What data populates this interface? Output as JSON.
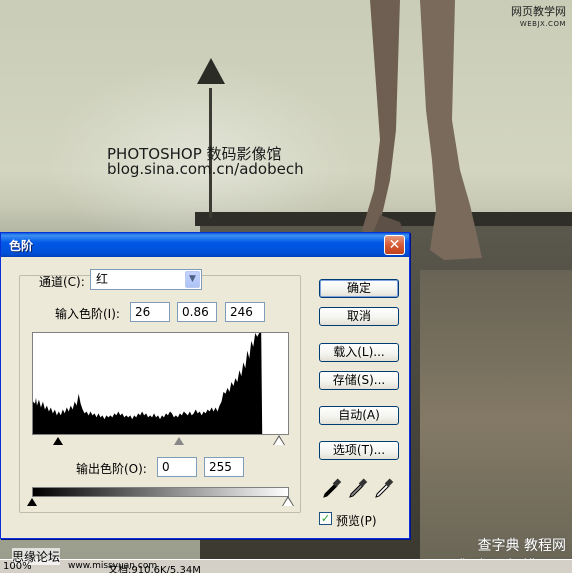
{
  "background": {
    "watermark_title": "PHOTOSHOP 数码影像馆",
    "watermark_blog": "blog.sina.com.cn/adobech",
    "site_logo_top": "网页教学网",
    "site_logo_top_sub": "WEBJX.COM",
    "site_logo_bottom": "查字典 教程网",
    "site_logo_bottom_sub": "jiaocheng.chazidian.com"
  },
  "status_bar": {
    "zoom": "100%",
    "forum": "思缘论坛",
    "url": "www.missyuan.com",
    "doc_info": "文档:910.6K/5.34M"
  },
  "dialog": {
    "title": "色阶",
    "close_glyph": "✕",
    "channel_label": "通道(C):",
    "channel_value": "红",
    "input_levels_label": "输入色阶(I):",
    "input_black": "26",
    "input_gamma": "0.86",
    "input_white": "246",
    "output_levels_label": "输出色阶(O):",
    "output_black": "0",
    "output_white": "255",
    "buttons": {
      "ok": "确定",
      "cancel": "取消",
      "load": "载入(L)...",
      "save": "存储(S)...",
      "auto": "自动(A)",
      "options": "选项(T)..."
    },
    "preview_label": "预览(P)",
    "preview_checked": true
  },
  "colors": {
    "title_bar": "#0058e6",
    "dialog_bg": "#ece9d8",
    "close_button": "#d65a34"
  }
}
